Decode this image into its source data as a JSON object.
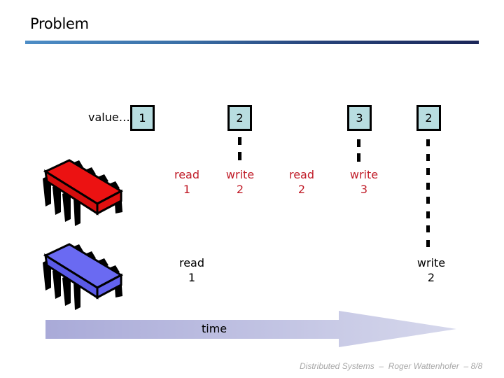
{
  "slide": {
    "title": "Problem",
    "footer": "Distributed Systems  –  Roger Wattenhofer  – 8/8"
  },
  "register": {
    "label": "value…",
    "values": [
      "1",
      "2",
      "3",
      "2"
    ]
  },
  "processes": [
    {
      "name": "red-processor",
      "color": "#e81010",
      "operations": [
        {
          "type": "read",
          "value": "1"
        },
        {
          "type": "write",
          "value": "2"
        },
        {
          "type": "read",
          "value": "2"
        },
        {
          "type": "write",
          "value": "3"
        }
      ]
    },
    {
      "name": "blue-processor",
      "color": "#6464f0",
      "operations": [
        {
          "type": "read",
          "value": "1"
        },
        {
          "type": "write",
          "value": "2"
        }
      ]
    }
  ],
  "timeline": {
    "label": "time"
  },
  "colors": {
    "box_fill": "#b8dde0",
    "red_text": "#c01c28",
    "arrow": "#b4b6dc"
  }
}
